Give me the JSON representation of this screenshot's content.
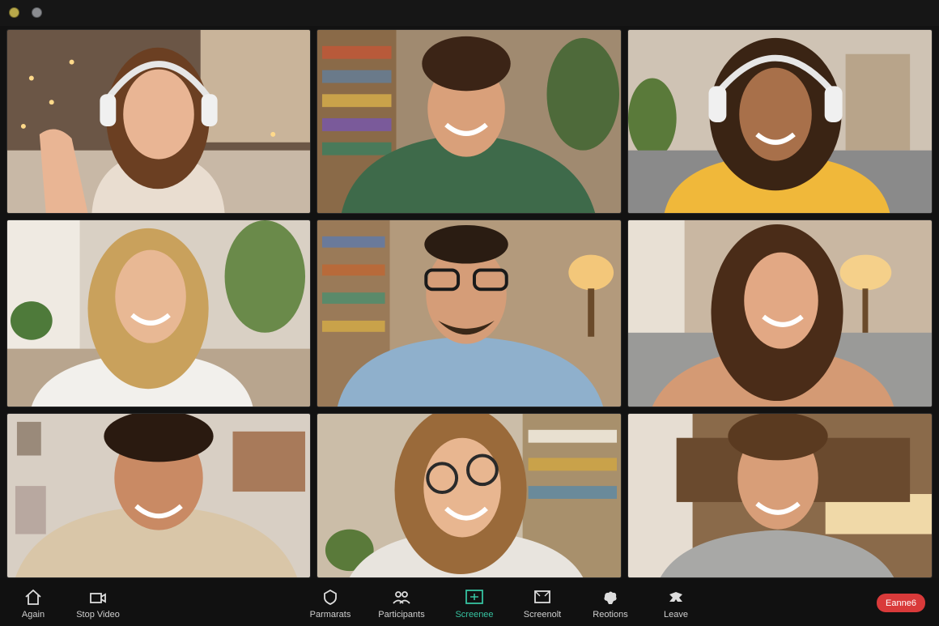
{
  "window": {
    "controls": [
      "minimize-dot",
      "close-dot"
    ]
  },
  "participants": [
    {
      "tile": 1,
      "icon": "participant-video-feed"
    },
    {
      "tile": 2,
      "icon": "participant-video-feed"
    },
    {
      "tile": 3,
      "icon": "participant-video-feed"
    },
    {
      "tile": 4,
      "icon": "participant-video-feed"
    },
    {
      "tile": 5,
      "icon": "participant-video-feed"
    },
    {
      "tile": 6,
      "icon": "participant-video-feed"
    },
    {
      "tile": 7,
      "icon": "participant-video-feed"
    },
    {
      "tile": 8,
      "icon": "participant-video-feed"
    },
    {
      "tile": 9,
      "icon": "participant-video-feed"
    }
  ],
  "toolbar": {
    "items": [
      {
        "label": "Again",
        "icon": "home-icon"
      },
      {
        "label": "Stop Video",
        "icon": "video-camera-icon"
      },
      {
        "label": "Parmarats",
        "icon": "security-icon"
      },
      {
        "label": "Participants",
        "icon": "participants-icon"
      },
      {
        "label": "Screenee",
        "icon": "share-screen-icon"
      },
      {
        "label": "Screenolt",
        "icon": "screenshot-icon"
      },
      {
        "label": "Reotions",
        "icon": "reactions-icon"
      },
      {
        "label": "Leave",
        "icon": "leave-icon"
      }
    ],
    "end_label": "Eanne6"
  },
  "colors": {
    "active": "#36c2a0",
    "end": "#d93a3a",
    "background": "#121212"
  }
}
